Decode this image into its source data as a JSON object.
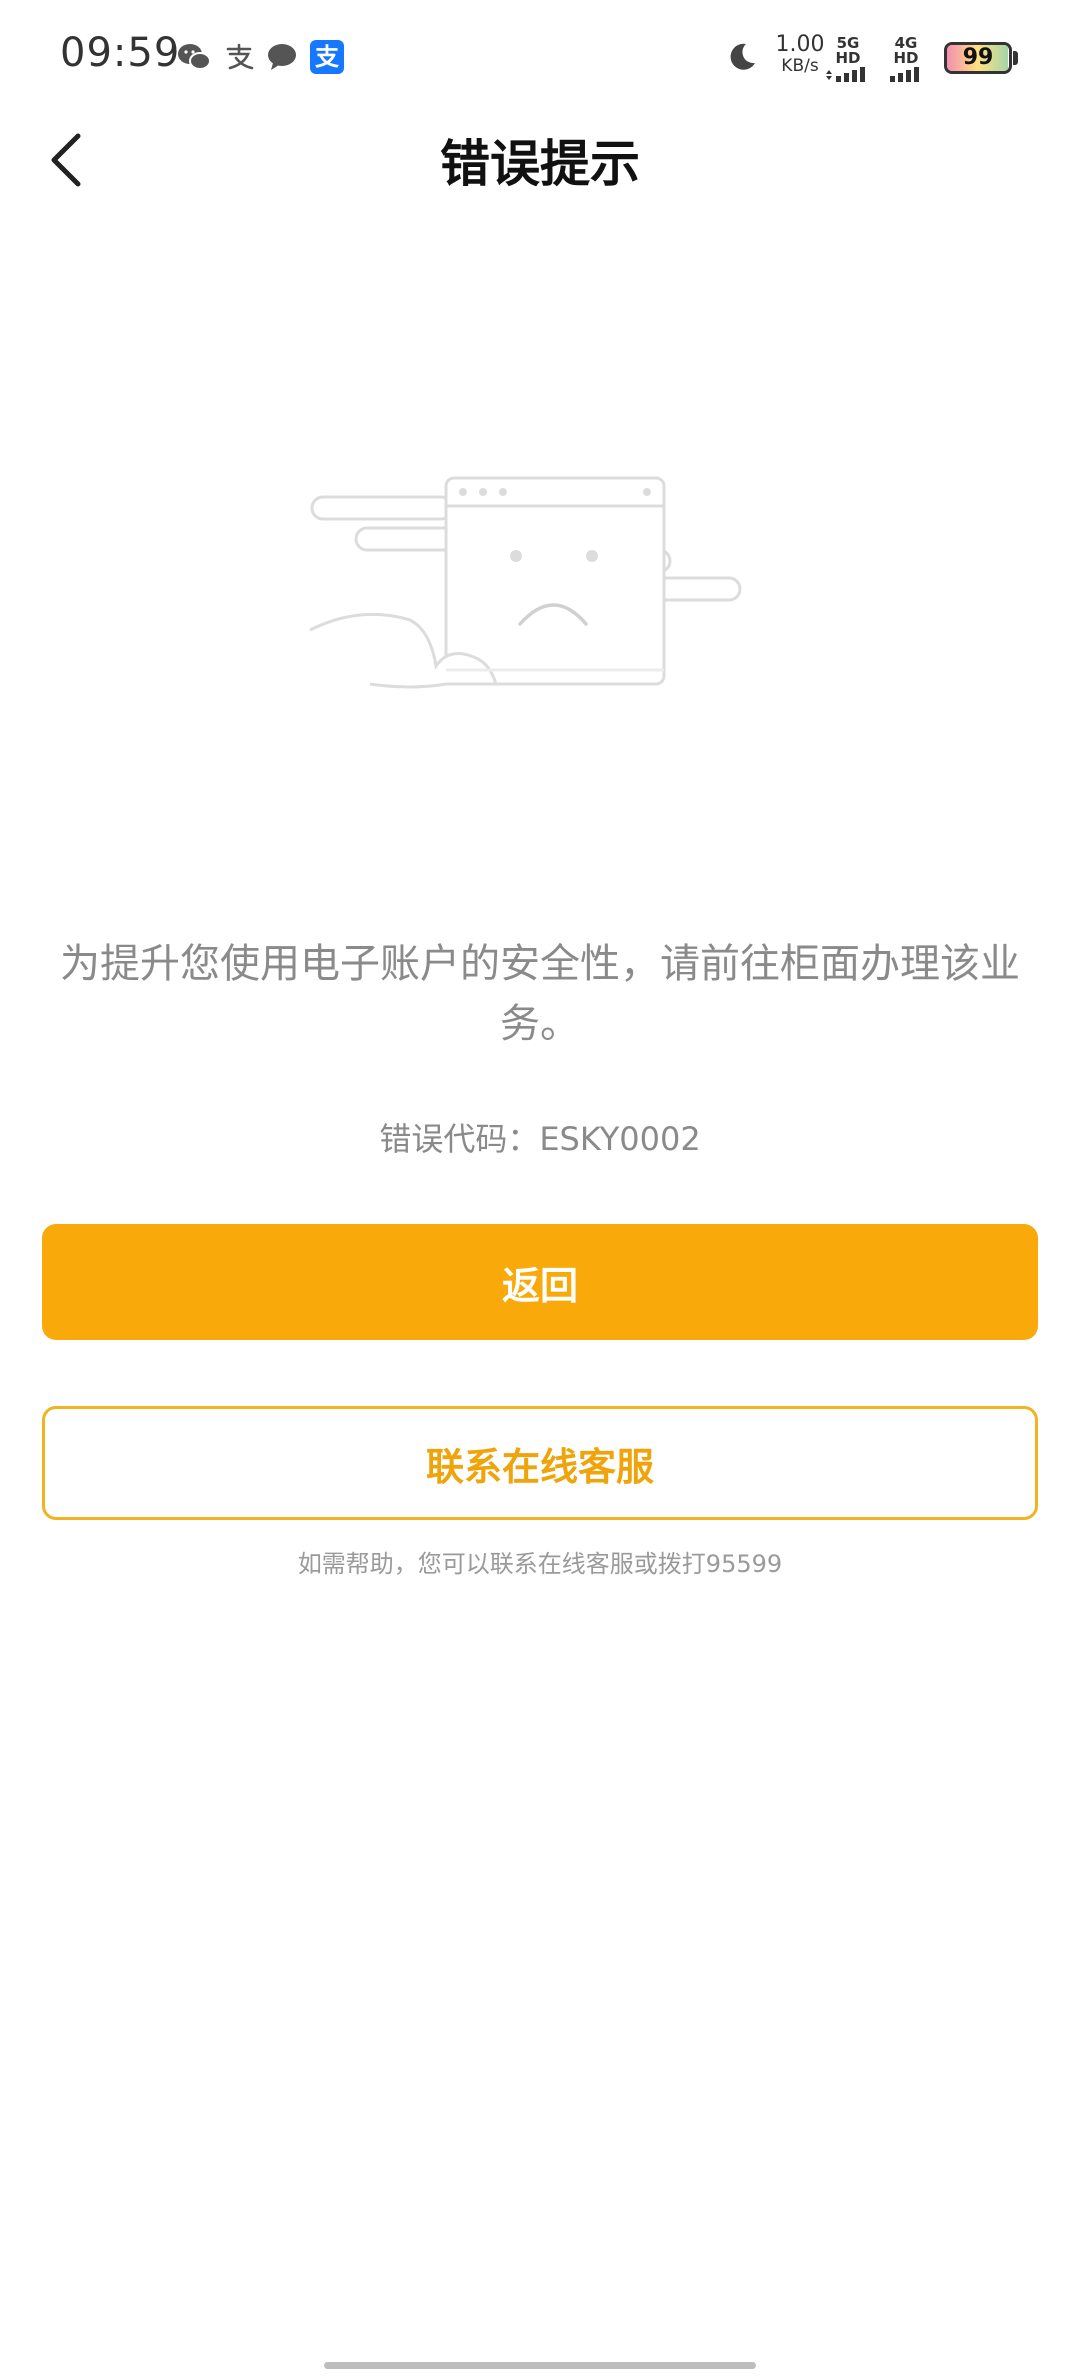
{
  "status_bar": {
    "time": "09:59",
    "notification_icons": [
      "wechat-icon",
      "alipay-outline-icon",
      "message-icon",
      "alipay-app-icon"
    ],
    "alipay_glyph": "支",
    "net_speed_value": "1.00",
    "net_speed_unit": "KB/s",
    "network_1": "5G HD",
    "network_2": "4G HD",
    "battery_level": "99",
    "battery_fraction": 0.99
  },
  "nav": {
    "title": "错误提示"
  },
  "content": {
    "message": "为提升您使用电子账户的安全性，请前往柜面办理该业务。",
    "error_code": "错误代码：ESKY0002"
  },
  "buttons": {
    "back_label": "返回",
    "contact_label": "联系在线客服"
  },
  "help": {
    "text": "如需帮助，您可以联系在线客服或拨打95599"
  },
  "colors": {
    "primary": "#f9aa0a",
    "outline": "#f0b322",
    "text_gray": "#8a8a8a"
  }
}
